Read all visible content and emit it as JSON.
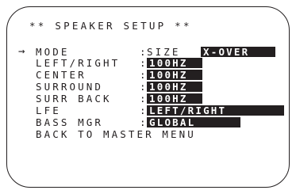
{
  "title": "** SPEAKER SETUP **",
  "cursor": "→",
  "separator": ":",
  "rows": [
    {
      "label": "MODE",
      "value_plain": "SIZE",
      "value": "X-OVER"
    },
    {
      "label": "LEFT/RIGHT",
      "value": "100HZ"
    },
    {
      "label": "CENTER",
      "value": "100HZ"
    },
    {
      "label": "SURROUND",
      "value": "100HZ"
    },
    {
      "label": "SURR BACK",
      "value": "100HZ"
    },
    {
      "label": "LFE",
      "value": "LEFT/RIGHT"
    },
    {
      "label": "BASS MGR",
      "value": "GLOBAL"
    }
  ],
  "back": "BACK TO MASTER MENU",
  "colors": {
    "foreground": "#231f20",
    "background": "#ffffff",
    "highlight_text": "#ffffff"
  }
}
